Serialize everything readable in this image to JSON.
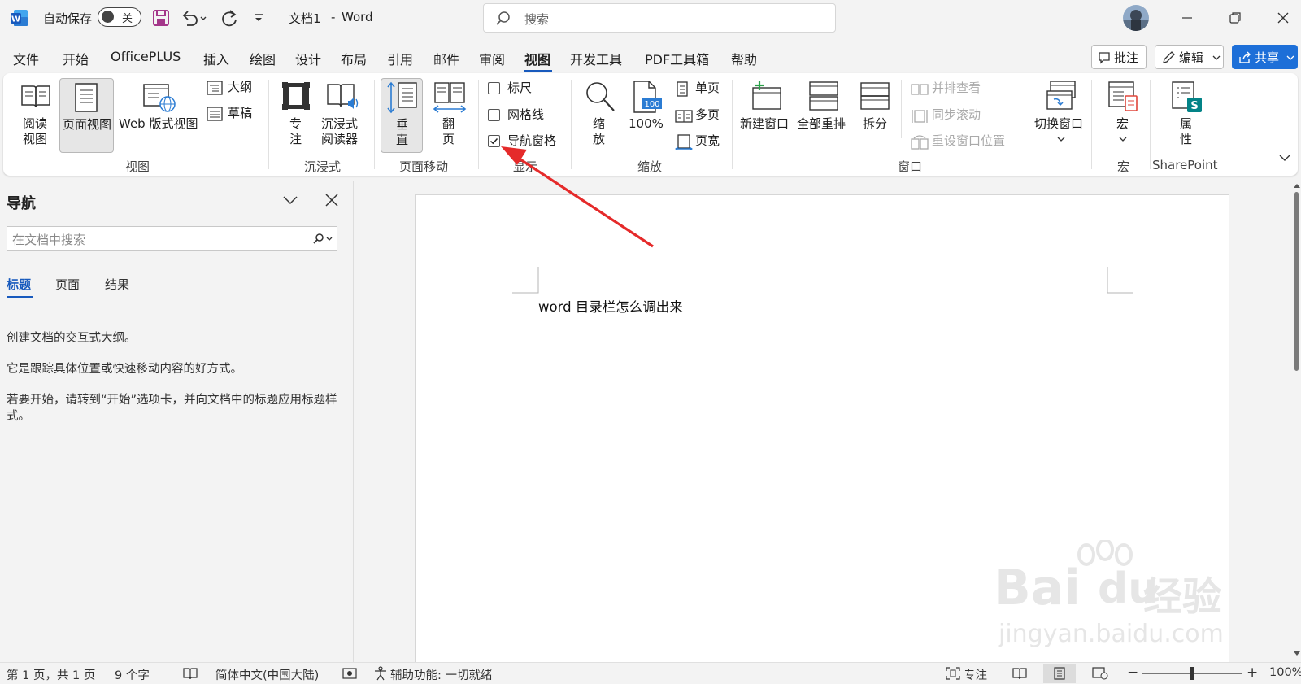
{
  "titlebar": {
    "autosave_label": "自动保存",
    "autosave_state": "关",
    "doc_title": "文档1",
    "title_sep": "-",
    "app_name": "Word",
    "search_placeholder": "搜索"
  },
  "menu": {
    "tabs": [
      "文件",
      "开始",
      "OfficePLUS",
      "插入",
      "绘图",
      "设计",
      "布局",
      "引用",
      "邮件",
      "审阅",
      "视图",
      "开发工具",
      "PDF工具箱",
      "帮助"
    ],
    "active_tab": "视图",
    "comment_button": "批注",
    "edit_button": "编辑",
    "share_button": "共享"
  },
  "ribbon": {
    "views": {
      "read_line1": "阅读",
      "read_line2": "视图",
      "print_layout": "页面视图",
      "web_layout": "Web 版式视图",
      "outline": "大纲",
      "draft": "草稿",
      "group": "视图"
    },
    "immersive": {
      "focus_line1": "专",
      "focus_line2": "注",
      "reader_line1": "沉浸式",
      "reader_line2": "阅读器",
      "group": "沉浸式"
    },
    "page_movement": {
      "vertical_line1": "垂",
      "vertical_line2": "直",
      "side_line1": "翻",
      "side_line2": "页",
      "group": "页面移动"
    },
    "show": {
      "ruler": "标尺",
      "gridlines": "网格线",
      "nav_pane": "导航窗格",
      "ruler_checked": false,
      "gridlines_checked": false,
      "nav_pane_checked": true,
      "group": "显示"
    },
    "zoom": {
      "zoom_line1": "缩",
      "zoom_line2": "放",
      "hundred_icon": "100",
      "hundred": "100%",
      "one_page": "单页",
      "multi_page": "多页",
      "page_width": "页宽",
      "group": "缩放"
    },
    "window": {
      "new_window": "新建窗口",
      "arrange_all": "全部重排",
      "split": "拆分",
      "side_by_side": "并排查看",
      "sync_scroll": "同步滚动",
      "reset_position": "重设窗口位置",
      "switch_windows": "切换窗口",
      "group": "窗口"
    },
    "macros": {
      "label": "宏",
      "group": "宏"
    },
    "sharepoint": {
      "prop_line1": "属",
      "prop_line2": "性",
      "group": "SharePoint"
    }
  },
  "nav_pane": {
    "title": "导航",
    "search_placeholder": "在文档中搜索",
    "tabs": [
      "标题",
      "页面",
      "结果"
    ],
    "active_tab": "标题",
    "help_1": "创建文档的交互式大纲。",
    "help_2": "它是跟踪具体位置或快速移动内容的好方式。",
    "help_3": "若要开始，请转到“开始”选项卡，并向文档中的标题应用标题样式。"
  },
  "document": {
    "text": "word 目录栏怎么调出来"
  },
  "status": {
    "page": "第 1 页，共 1 页",
    "words": "9 个字",
    "language": "简体中文(中国大陆)",
    "accessibility": "辅助功能: 一切就绪",
    "focus": "专注",
    "zoom_level": "100%",
    "zoom_fraction": 0.5
  },
  "watermark": {
    "brand": "Bai",
    "brand2": "du",
    "brand_cn": "经验",
    "url": "jingyan.baidu.com"
  },
  "colors": {
    "accent": "#185abd",
    "share_bg": "#1d6fd8",
    "word_icon": "#185abd",
    "save_icon": "#a4368a",
    "arrow": "#e52a2a"
  },
  "icons": [
    "word-logo-icon",
    "save-icon",
    "undo-icon",
    "redo-icon",
    "customize-icon",
    "search-icon",
    "avatar",
    "minimize-icon",
    "restore-icon",
    "close-icon"
  ]
}
